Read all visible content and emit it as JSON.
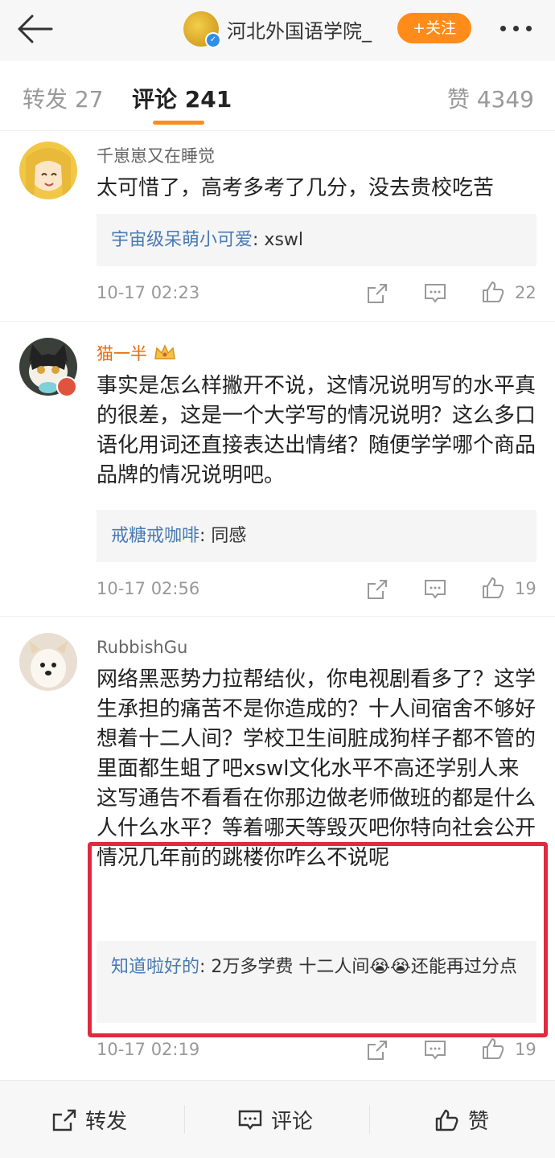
{
  "header": {
    "account_name": "河北外国语学院_",
    "follow_label": "+关注"
  },
  "tabs": [
    {
      "label": "转发 27"
    },
    {
      "label": "评论 241"
    },
    {
      "label": "赞 4349"
    }
  ],
  "comments": [
    {
      "username": "千崽崽又在睡觉",
      "text": "太可惜了，高考多考了几分，没去贵校吃苦",
      "reply_name": "宇宙级呆萌小可爱",
      "reply_text": ": xswl",
      "time": "10-17 02:23",
      "likes": "22"
    },
    {
      "username": "猫一半",
      "text": "事实是怎么样撇开不说，这情况说明写的水平真的很差，这是一个大学写的情况说明？这么多口语化用词还直接表达出情绪？随便学学哪个商品品牌的情况说明吧。",
      "reply_name": "戒糖戒咖啡",
      "reply_text": ": 同感",
      "time": "10-17 02:56",
      "likes": "19"
    },
    {
      "username": "RubbishGu",
      "text": "网络黑恶势力拉帮结伙，你电视剧看多了？这学生承担的痛苦不是你造成的？十人间宿舍不够好想着十二人间？学校卫生间脏成狗样子都不管的里面都生蛆了吧xswl文化水平不高还学别人来这写通告不看看在你那边做老师做班的都是什么人什么水平？等着哪天等毁灭吧你特向社会公开情况几年前的跳楼你咋么不说呢",
      "reply_name": "知道啦好的",
      "reply_text": ": 2万多学费  十二人间😭😭还能再过分点",
      "time": "10-17 02:19",
      "likes": "19"
    }
  ],
  "bottom_bar": {
    "repost": "转发",
    "comment": "评论",
    "like": "赞"
  },
  "colors": {
    "accent": "#ff8c1a",
    "link": "#4a7ab4",
    "highlight_frame": "#e02a3e"
  }
}
